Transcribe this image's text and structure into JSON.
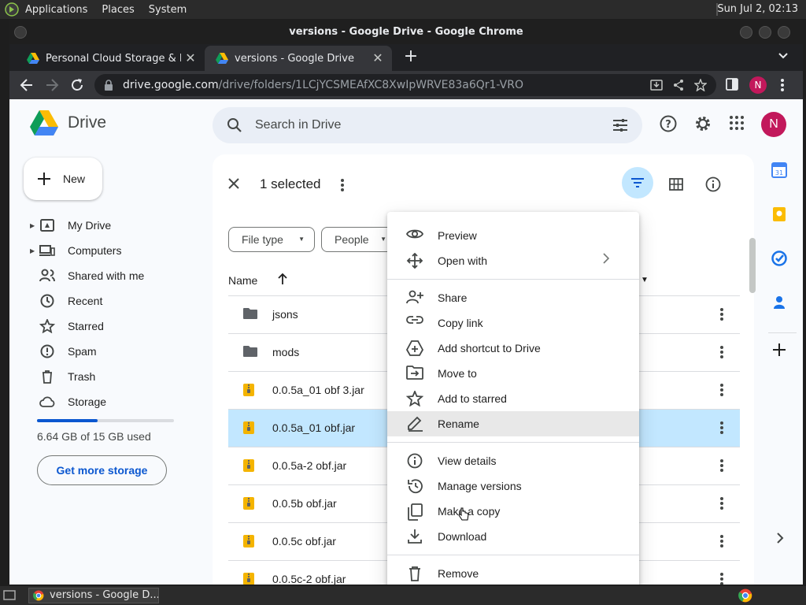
{
  "os_panel": {
    "menus": [
      "Applications",
      "Places",
      "System"
    ],
    "clock": "Sun Jul  2, 02:13"
  },
  "window": {
    "title": "versions - Google Drive - Google Chrome"
  },
  "tabs": [
    {
      "label": "Personal Cloud Storage & File",
      "active": false
    },
    {
      "label": "versions - Google Drive",
      "active": true
    }
  ],
  "address_bar": {
    "host": "drive.google.com",
    "path": "/drive/folders/1LCjYCSMEAfXC8XwIpWRVE83a6Qr1-VRO"
  },
  "profile_initial": "N",
  "drive": {
    "app_name": "Drive",
    "search_placeholder": "Search in Drive",
    "new_button": "New",
    "nav": [
      {
        "label": "My Drive",
        "icon": "my-drive-icon",
        "expandable": true
      },
      {
        "label": "Computers",
        "icon": "computers-icon",
        "expandable": true
      },
      {
        "label": "Shared with me",
        "icon": "shared-icon",
        "expandable": false
      },
      {
        "label": "Recent",
        "icon": "recent-icon",
        "expandable": false
      },
      {
        "label": "Starred",
        "icon": "star-icon",
        "expandable": false
      },
      {
        "label": "Spam",
        "icon": "spam-icon",
        "expandable": false
      },
      {
        "label": "Trash",
        "icon": "trash-icon",
        "expandable": false
      },
      {
        "label": "Storage",
        "icon": "cloud-icon",
        "expandable": false
      }
    ],
    "storage": {
      "used_text": "6.64 GB of 15 GB used",
      "used_fraction": 0.443,
      "cta": "Get more storage"
    },
    "selection": {
      "count_label": "1 selected"
    },
    "filters": [
      "File type",
      "People"
    ],
    "list_header": {
      "name": "Name"
    },
    "files": [
      {
        "name": "jsons",
        "type": "folder",
        "selected": false
      },
      {
        "name": "mods",
        "type": "folder",
        "selected": false
      },
      {
        "name": "0.0.5a_01 obf 3.jar",
        "type": "archive",
        "selected": false
      },
      {
        "name": "0.0.5a_01 obf.jar",
        "type": "archive",
        "selected": true
      },
      {
        "name": "0.0.5a-2 obf.jar",
        "type": "archive",
        "selected": false
      },
      {
        "name": "0.0.5b obf.jar",
        "type": "archive",
        "selected": false
      },
      {
        "name": "0.0.5c obf.jar",
        "type": "archive",
        "selected": false
      },
      {
        "name": "0.0.5c-2 obf.jar",
        "type": "archive",
        "selected": false
      }
    ],
    "context_menu": {
      "groups": [
        [
          {
            "label": "Preview",
            "icon": "eye-icon",
            "submenu": false
          },
          {
            "label": "Open with",
            "icon": "move-arrows-icon",
            "submenu": true
          }
        ],
        [
          {
            "label": "Share",
            "icon": "person-add-icon",
            "submenu": false
          },
          {
            "label": "Copy link",
            "icon": "link-icon",
            "submenu": false
          },
          {
            "label": "Add shortcut to Drive",
            "icon": "add-shortcut-icon",
            "submenu": false
          },
          {
            "label": "Move to",
            "icon": "move-to-icon",
            "submenu": false
          },
          {
            "label": "Add to starred",
            "icon": "star-outline-icon",
            "submenu": false
          },
          {
            "label": "Rename",
            "icon": "pencil-icon",
            "submenu": false,
            "hover": true
          }
        ],
        [
          {
            "label": "View details",
            "icon": "info-icon",
            "submenu": false
          },
          {
            "label": "Manage versions",
            "icon": "history-icon",
            "submenu": false
          },
          {
            "label": "Make a copy",
            "icon": "copy-icon",
            "submenu": false
          },
          {
            "label": "Download",
            "icon": "download-icon",
            "submenu": false
          }
        ],
        [
          {
            "label": "Remove",
            "icon": "trash-icon",
            "submenu": false
          }
        ]
      ]
    }
  },
  "taskbar": {
    "item": "versions - Google D..."
  },
  "colors": {
    "accent": "#0b57d0",
    "selected_row": "#c2e7ff",
    "avatar": "#c2185b"
  }
}
